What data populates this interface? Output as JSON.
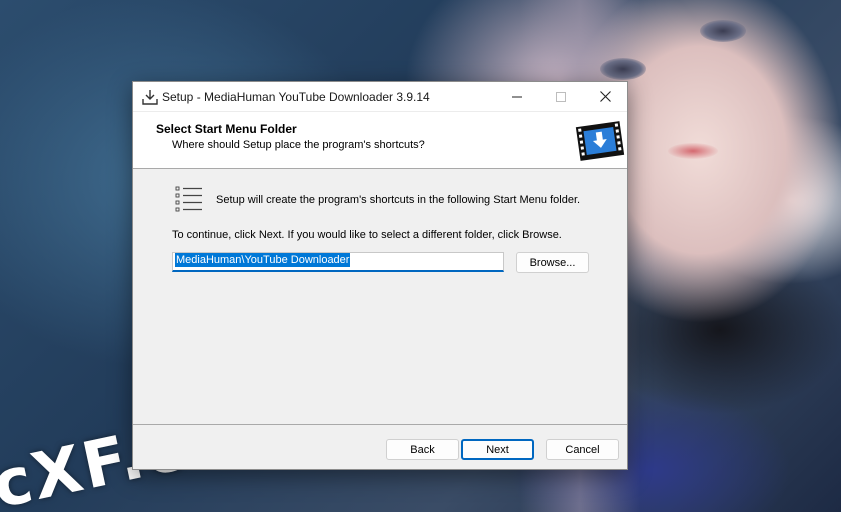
{
  "window": {
    "title": "Setup - MediaHuman YouTube Downloader 3.9.14"
  },
  "header": {
    "title": "Select Start Menu Folder",
    "subtitle": "Where should Setup place the program's shortcuts?"
  },
  "body": {
    "info": "Setup will create the program's shortcuts in the following Start Menu folder.",
    "continue": "To continue, click Next. If you would like to select a different folder, click Browse.",
    "folder_value": "MediaHuman\\YouTube Downloader"
  },
  "buttons": {
    "browse": "Browse...",
    "back": "Back",
    "next": "Next",
    "cancel": "Cancel"
  },
  "wallpaper": {
    "watermark": "cXF.c"
  },
  "colors": {
    "accent": "#0067c0",
    "selection": "#0078d7"
  }
}
